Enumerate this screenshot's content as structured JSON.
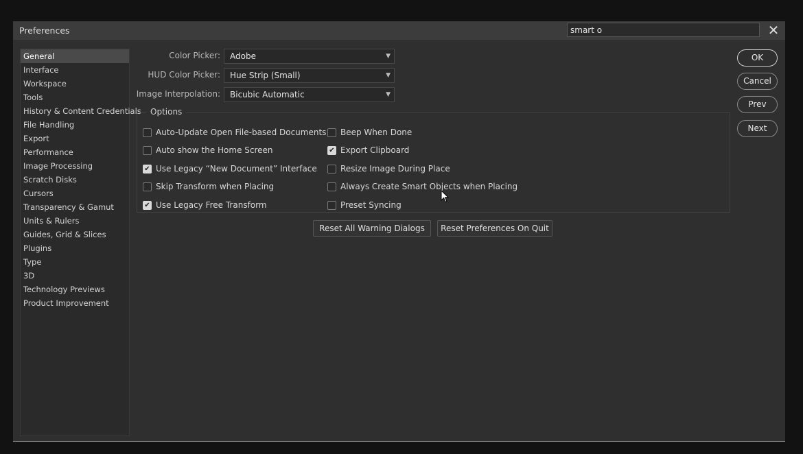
{
  "window": {
    "title": "Preferences"
  },
  "search": {
    "value": "smart o"
  },
  "sidebar": {
    "items": [
      {
        "label": "General",
        "active": true
      },
      {
        "label": "Interface"
      },
      {
        "label": "Workspace"
      },
      {
        "label": "Tools"
      },
      {
        "label": "History & Content Credentials"
      },
      {
        "label": "File Handling"
      },
      {
        "label": "Export"
      },
      {
        "label": "Performance"
      },
      {
        "label": "Image Processing"
      },
      {
        "label": "Scratch Disks"
      },
      {
        "label": "Cursors"
      },
      {
        "label": "Transparency & Gamut"
      },
      {
        "label": "Units & Rulers"
      },
      {
        "label": "Guides, Grid & Slices"
      },
      {
        "label": "Plugins"
      },
      {
        "label": "Type"
      },
      {
        "label": "3D"
      },
      {
        "label": "Technology Previews"
      },
      {
        "label": "Product Improvement"
      }
    ]
  },
  "fields": {
    "color_picker": {
      "label": "Color Picker:",
      "value": "Adobe"
    },
    "hud_color_picker": {
      "label": "HUD Color Picker:",
      "value": "Hue Strip (Small)"
    },
    "image_interpolation": {
      "label": "Image Interpolation:",
      "value": "Bicubic Automatic"
    }
  },
  "options": {
    "legend": "Options",
    "left": [
      {
        "label": "Auto-Update Open File-based Documents",
        "checked": false
      },
      {
        "label": "Auto show the Home Screen",
        "checked": false
      },
      {
        "label": "Use Legacy “New Document” Interface",
        "checked": true
      },
      {
        "label": "Skip Transform when Placing",
        "checked": false
      },
      {
        "label": "Use Legacy Free Transform",
        "checked": true
      }
    ],
    "right": [
      {
        "label": "Beep When Done",
        "checked": false
      },
      {
        "label": "Export Clipboard",
        "checked": true
      },
      {
        "label": "Resize Image During Place",
        "checked": false
      },
      {
        "label": "Always Create Smart Objects when Placing",
        "checked": false
      },
      {
        "label": "Preset Syncing",
        "checked": false
      }
    ]
  },
  "buttons": {
    "reset_warnings": "Reset All Warning Dialogs",
    "reset_prefs": "Reset Preferences On Quit",
    "ok": "OK",
    "cancel": "Cancel",
    "prev": "Prev",
    "next": "Next"
  },
  "icons": {
    "close": "close-icon",
    "chevron": "chevron-down-icon",
    "checkmark": "checkmark-icon",
    "cursor": "mouse-pointer-icon"
  }
}
